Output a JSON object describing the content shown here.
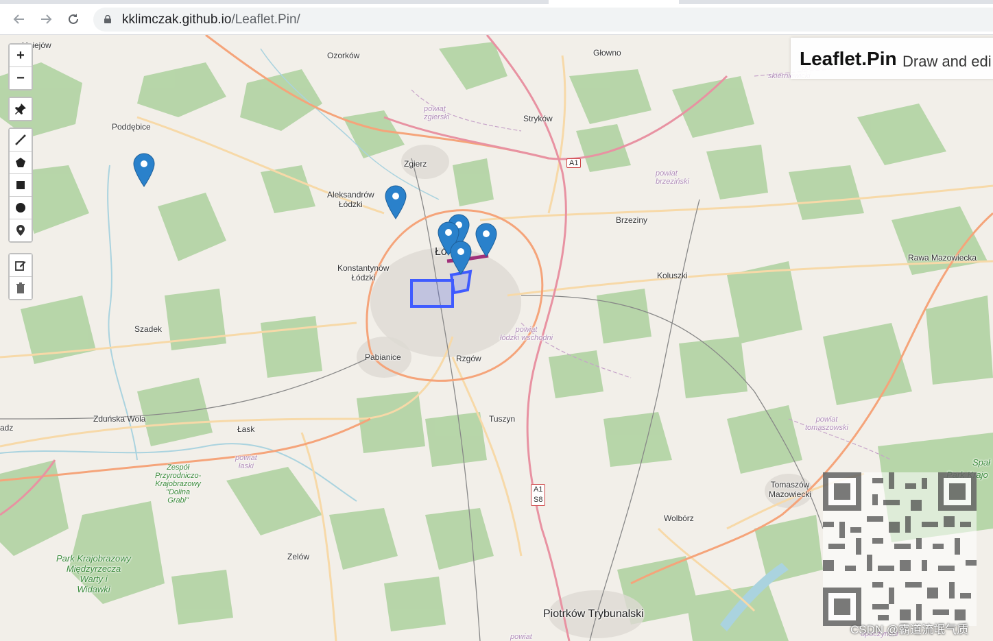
{
  "browser": {
    "url_host": "kklimczak.github.io",
    "url_path": "/Leaflet.Pin/",
    "icons": [
      "back-arrow-icon",
      "forward-arrow-icon",
      "reload-icon",
      "lock-icon"
    ]
  },
  "title_box": {
    "title": "Leaflet.Pin",
    "subtitle": "Draw and edi"
  },
  "controls": {
    "zoom_in": "+",
    "zoom_out": "−",
    "icons": [
      "pin-toggle-icon",
      "polyline-icon",
      "polygon-icon",
      "rectangle-icon",
      "circle-icon",
      "marker-icon",
      "edit-icon",
      "trash-icon"
    ]
  },
  "map": {
    "places": {
      "uniejow": "Uniejów",
      "ozorkow": "Ozorków",
      "glowno": "Głowno",
      "poddebice": "Poddębice",
      "powiat_zgierski": "powiat\nzgierski",
      "strykow": "Stryków",
      "a1_north": "A1",
      "zgierz": "Zgierz",
      "powiat_brzezinski": "powiat\nbrzeziński",
      "aleksandrow": "Aleksandrów\nŁódzki",
      "brzeziny": "Brzeziny",
      "lodz": "Łó",
      "konstantynow": "Konstantynów\nŁódzki",
      "rawa": "Rawa Mazowiecka",
      "koluszki": "Koluszki",
      "szadek": "Szadek",
      "powiat_lodzki": "powiat\nłódzki wschodni",
      "pabianice": "Pabianice",
      "rzgow": "Rzgów",
      "zdunska": "Zduńska Wola",
      "sieradz": "adz",
      "tuszyn": "Tuszyn",
      "lask": "Łask",
      "powiat_tomaszowski": "powiat\ntomaszowski",
      "zespol": "Zespół\nPrzyrodniczo-\nKrajobrazowy\n\"Dolina\nGrabi\"",
      "powiat_laski": "powiat\nłaski",
      "a1_s8_a": "A1",
      "a1_s8_b": "S8",
      "tomaszow": "Tomaszów\nMazowiecki",
      "wolborz": "Wolbórz",
      "spala": "Spał",
      "park_krajo": "Park Krajo",
      "park_miedzyrzecza": "Park Krajobrazowy\nMiędzyrzecza\nWarty i\nWidawki",
      "zelow": "Zelów",
      "piotrkow": "Piotrków Trybunalski",
      "powiat_skierniewicki": "po\nskierniewicki",
      "powiat_opoczynski": "opoczyński",
      "powiat_bottom": "powiat"
    }
  },
  "colors": {
    "map_bg": "#f2efe9",
    "forest": "#add19e",
    "motorway": "#e892a2",
    "primary_road": "#fcd6a4",
    "secondary_road": "#f7fabf",
    "water": "#aad3df",
    "marker": "#2a81cb",
    "drawn_shape": "#3f5bff",
    "drawn_line": "#a0307a"
  },
  "watermark": "CSDN @霸道流氓气质"
}
